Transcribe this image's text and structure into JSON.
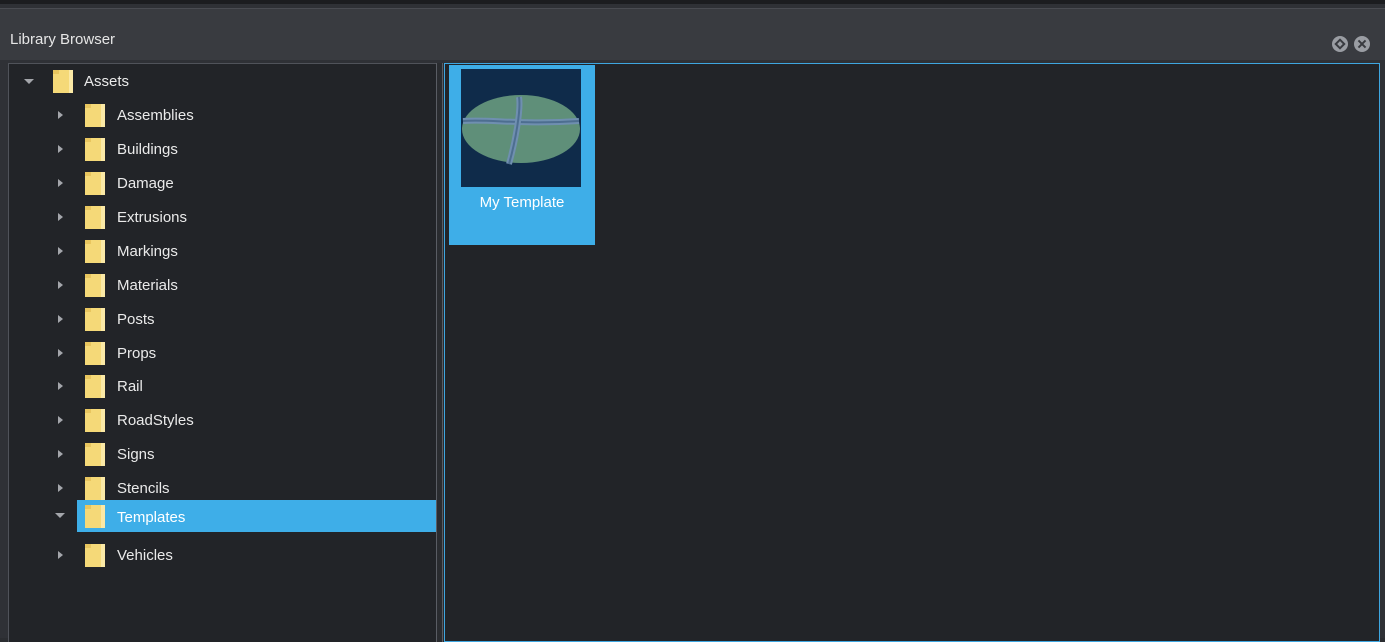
{
  "window": {
    "title": "Library Browser",
    "float_icon": "diamond-float-icon",
    "close_icon": "close-circle-icon"
  },
  "tree": {
    "root": {
      "label": "Assets",
      "expanded": true
    },
    "items": [
      {
        "label": "Assemblies",
        "expanded": false,
        "selected": false
      },
      {
        "label": "Buildings",
        "expanded": false,
        "selected": false
      },
      {
        "label": "Damage",
        "expanded": false,
        "selected": false
      },
      {
        "label": "Extrusions",
        "expanded": false,
        "selected": false
      },
      {
        "label": "Markings",
        "expanded": false,
        "selected": false
      },
      {
        "label": "Materials",
        "expanded": false,
        "selected": false
      },
      {
        "label": "Posts",
        "expanded": false,
        "selected": false
      },
      {
        "label": "Props",
        "expanded": false,
        "selected": false
      },
      {
        "label": "Rail",
        "expanded": false,
        "selected": false
      },
      {
        "label": "RoadStyles",
        "expanded": false,
        "selected": false
      },
      {
        "label": "Signs",
        "expanded": false,
        "selected": false
      },
      {
        "label": "Stencils",
        "expanded": false,
        "selected": false
      },
      {
        "label": "Templates",
        "expanded": true,
        "selected": true
      },
      {
        "label": "Vehicles",
        "expanded": false,
        "selected": false
      }
    ]
  },
  "content": {
    "items": [
      {
        "label": "My Template",
        "selected": true,
        "thumbnail": "road-intersection-thumbnail"
      }
    ]
  },
  "colors": {
    "selection": "#3eaee8",
    "folder": "#f5d978",
    "background": "#222428"
  }
}
